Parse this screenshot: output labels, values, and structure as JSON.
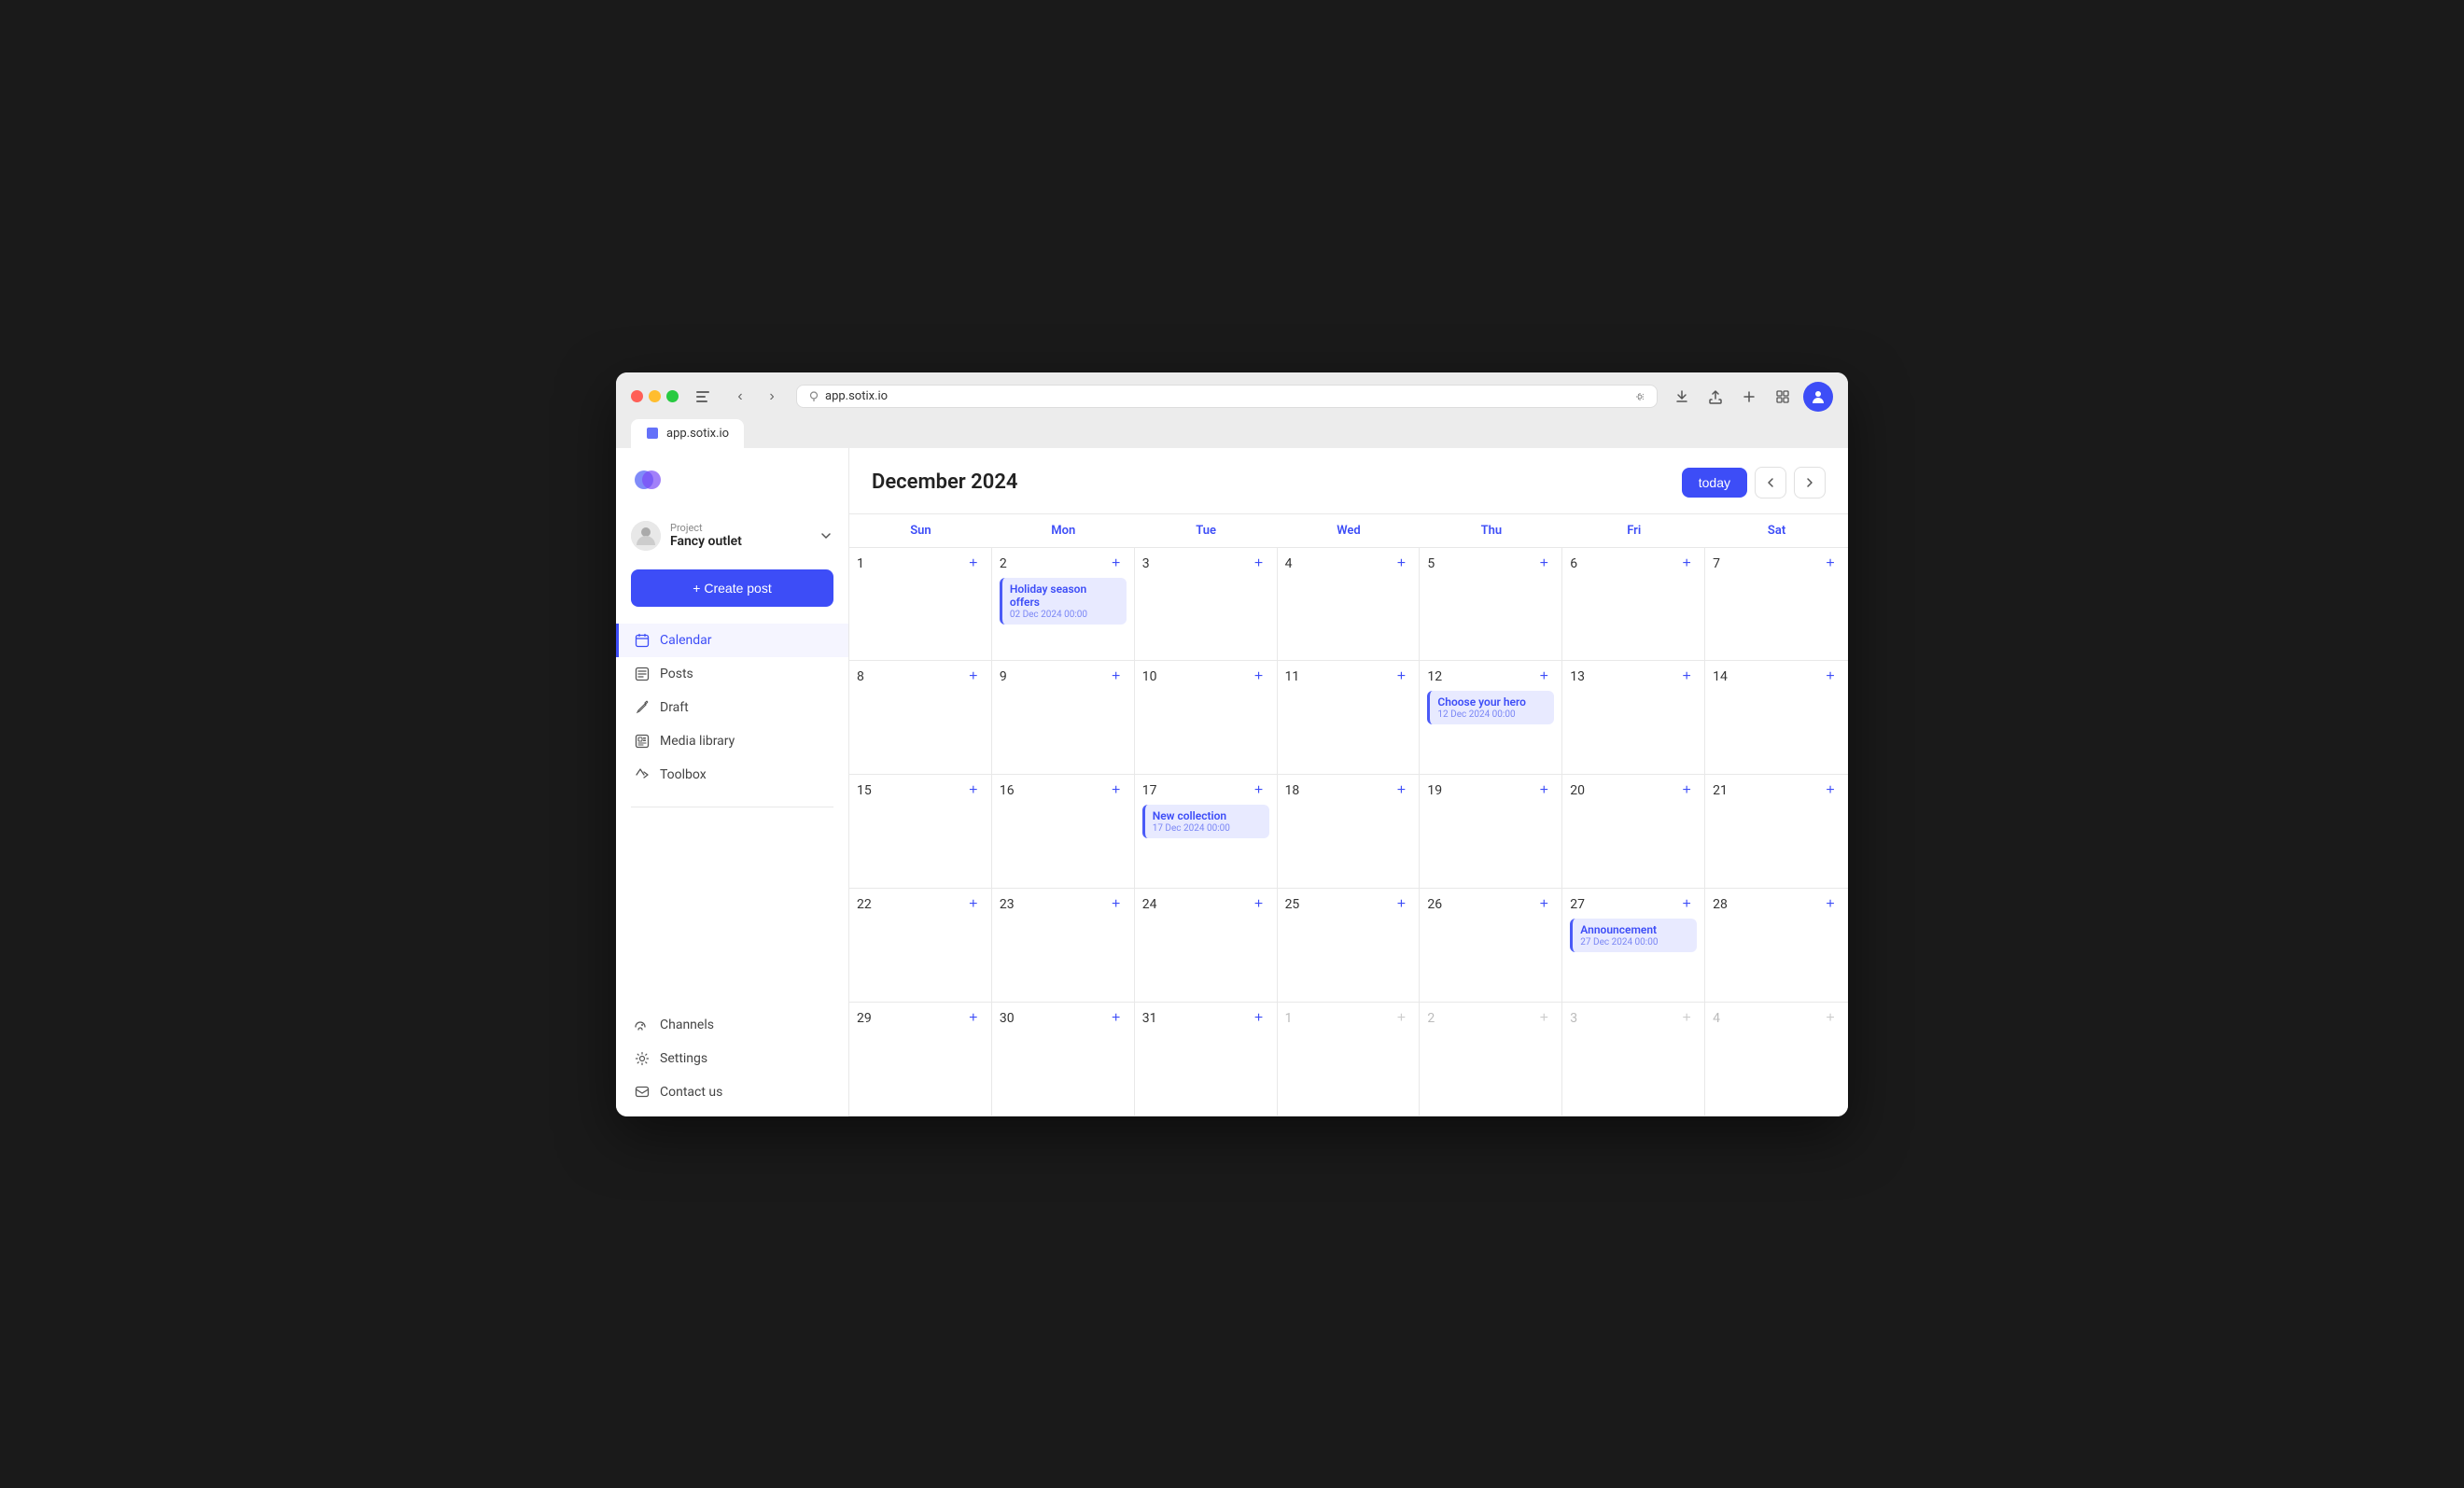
{
  "browser": {
    "url": "app.sotix.io",
    "tab_title": "app.sotix.io"
  },
  "app": {
    "logo_alt": "Sotix Logo"
  },
  "project": {
    "label": "Project",
    "name": "Fancy outlet"
  },
  "sidebar": {
    "create_post_label": "+ Create post",
    "nav_items": [
      {
        "id": "calendar",
        "label": "Calendar",
        "active": true
      },
      {
        "id": "posts",
        "label": "Posts",
        "active": false
      },
      {
        "id": "draft",
        "label": "Draft",
        "active": false
      },
      {
        "id": "media-library",
        "label": "Media library",
        "active": false
      },
      {
        "id": "toolbox",
        "label": "Toolbox",
        "active": false
      }
    ],
    "bottom_nav_items": [
      {
        "id": "channels",
        "label": "Channels"
      },
      {
        "id": "settings",
        "label": "Settings"
      },
      {
        "id": "contact-us",
        "label": "Contact us"
      }
    ]
  },
  "calendar": {
    "title": "December 2024",
    "today_label": "today",
    "days": [
      "Sun",
      "Mon",
      "Tue",
      "Wed",
      "Thu",
      "Fri",
      "Sat"
    ],
    "weeks": [
      [
        {
          "date": "1",
          "muted": false,
          "events": []
        },
        {
          "date": "2",
          "muted": false,
          "events": [
            {
              "title": "Holiday season offers",
              "time": "02 Dec 2024 00:00"
            }
          ]
        },
        {
          "date": "3",
          "muted": false,
          "events": []
        },
        {
          "date": "4",
          "muted": false,
          "events": []
        },
        {
          "date": "5",
          "muted": false,
          "events": []
        },
        {
          "date": "6",
          "muted": false,
          "events": []
        },
        {
          "date": "7",
          "muted": false,
          "events": []
        }
      ],
      [
        {
          "date": "8",
          "muted": false,
          "events": []
        },
        {
          "date": "9",
          "muted": false,
          "events": []
        },
        {
          "date": "10",
          "muted": false,
          "events": []
        },
        {
          "date": "11",
          "muted": false,
          "events": []
        },
        {
          "date": "12",
          "muted": false,
          "events": [
            {
              "title": "Choose your hero",
              "time": "12 Dec 2024 00:00"
            }
          ]
        },
        {
          "date": "13",
          "muted": false,
          "events": []
        },
        {
          "date": "14",
          "muted": false,
          "events": []
        }
      ],
      [
        {
          "date": "15",
          "muted": false,
          "events": []
        },
        {
          "date": "16",
          "muted": false,
          "events": []
        },
        {
          "date": "17",
          "muted": false,
          "events": [
            {
              "title": "New collection",
              "time": "17 Dec 2024 00:00"
            }
          ]
        },
        {
          "date": "18",
          "muted": false,
          "events": []
        },
        {
          "date": "19",
          "muted": false,
          "events": []
        },
        {
          "date": "20",
          "muted": false,
          "events": []
        },
        {
          "date": "21",
          "muted": false,
          "events": []
        }
      ],
      [
        {
          "date": "22",
          "muted": false,
          "events": []
        },
        {
          "date": "23",
          "muted": false,
          "events": []
        },
        {
          "date": "24",
          "muted": false,
          "events": []
        },
        {
          "date": "25",
          "muted": false,
          "events": []
        },
        {
          "date": "26",
          "muted": false,
          "events": []
        },
        {
          "date": "27",
          "muted": false,
          "events": [
            {
              "title": "Announcement",
              "time": "27 Dec 2024 00:00"
            }
          ]
        },
        {
          "date": "28",
          "muted": false,
          "events": []
        }
      ],
      [
        {
          "date": "29",
          "muted": false,
          "events": []
        },
        {
          "date": "30",
          "muted": false,
          "events": []
        },
        {
          "date": "31",
          "muted": false,
          "events": []
        },
        {
          "date": "1",
          "muted": true,
          "events": []
        },
        {
          "date": "2",
          "muted": true,
          "events": []
        },
        {
          "date": "3",
          "muted": true,
          "events": []
        },
        {
          "date": "4",
          "muted": true,
          "events": []
        }
      ]
    ]
  }
}
